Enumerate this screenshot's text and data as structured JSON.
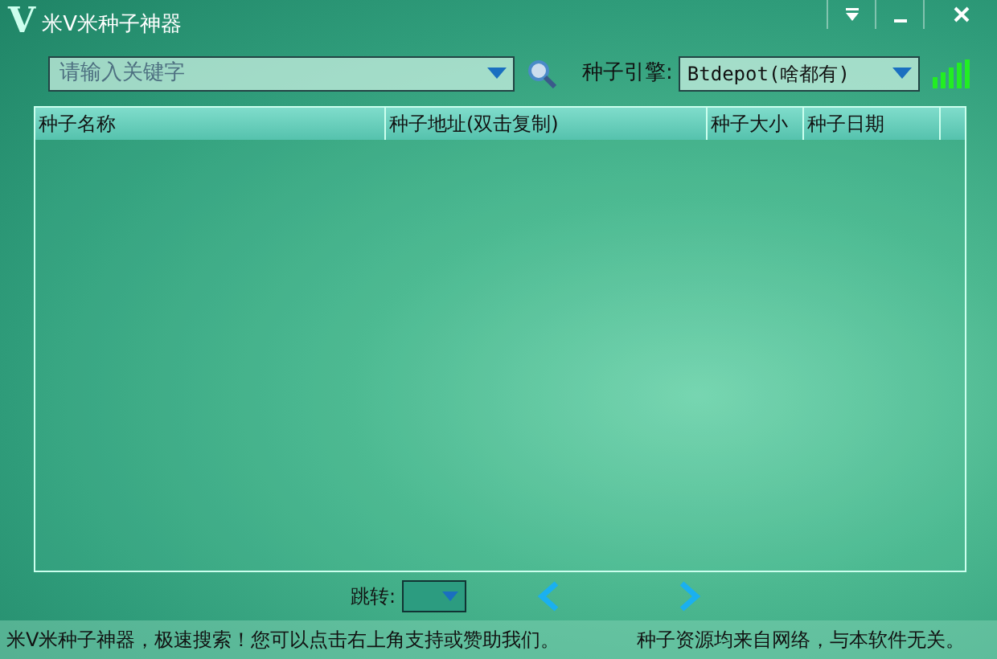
{
  "window": {
    "title": "米V米种子神器",
    "logo": "V"
  },
  "search": {
    "placeholder": "请输入关键字"
  },
  "engine": {
    "label": "种子引擎:",
    "value": "Btdepot(啥都有)"
  },
  "table": {
    "columns": [
      "种子名称",
      "种子地址(双击复制)",
      "种子大小",
      "种子日期"
    ]
  },
  "pager": {
    "label": "跳转:"
  },
  "status_bar": [
    "米V米种子神器，极速搜索！您可以点击右上角支持或赞助我们。",
    "种子资源均来自网络，与本软件无关。"
  ]
}
